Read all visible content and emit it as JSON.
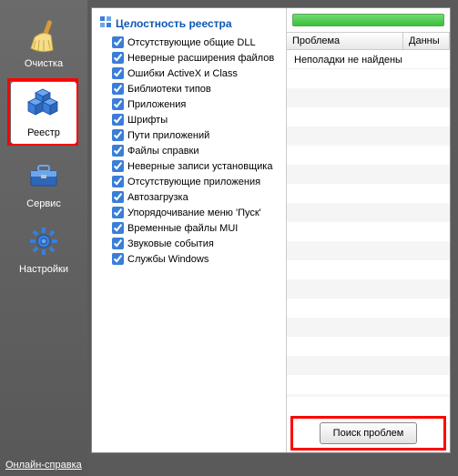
{
  "sidebar": {
    "items": [
      {
        "label": "Очистка",
        "icon": "broom-icon"
      },
      {
        "label": "Реестр",
        "icon": "registry-cubes-icon",
        "selected": true
      },
      {
        "label": "Сервис",
        "icon": "toolbox-icon"
      },
      {
        "label": "Настройки",
        "icon": "gear-icon"
      }
    ]
  },
  "checks": {
    "title": "Целостность реестра",
    "items": [
      "Отсутствующие общие DLL",
      "Неверные расширения файлов",
      "Ошибки ActiveX и Class",
      "Библиотеки типов",
      "Приложения",
      "Шрифты",
      "Пути приложений",
      "Файлы справки",
      "Неверные записи установщика",
      "Отсутствующие приложения",
      "Автозагрузка",
      "Упорядочивание меню 'Пуск'",
      "Временные файлы MUI",
      "Звуковые события",
      "Службы Windows"
    ]
  },
  "results": {
    "columns": {
      "problem": "Проблема",
      "data": "Данны"
    },
    "rows": [
      "Неполадки не найдены"
    ]
  },
  "buttons": {
    "scan": "Поиск проблем"
  },
  "footer": {
    "help": "Онлайн-справка"
  }
}
